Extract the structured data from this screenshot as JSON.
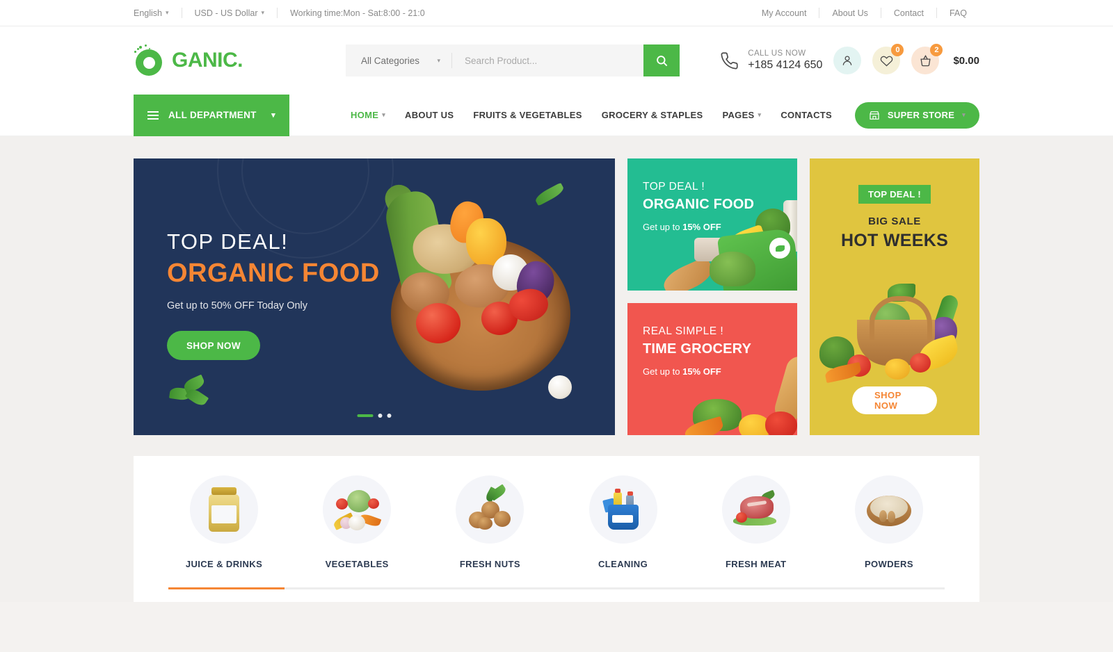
{
  "topbar": {
    "language": "English",
    "currency": "USD - US Dollar",
    "working_time": "Working time:Mon - Sat:8:00 - 21:0",
    "links": [
      {
        "label": "My Account"
      },
      {
        "label": "About Us"
      },
      {
        "label": "Contact"
      },
      {
        "label": "FAQ"
      }
    ]
  },
  "header": {
    "logo_letter": "C",
    "logo_text": "GANIC.",
    "search": {
      "category_selected": "All Categories",
      "placeholder": "Search Product...",
      "value": "",
      "button_icon": "search-icon"
    },
    "call": {
      "label": "CALL US NOW",
      "number": "+185 4124 650",
      "icon": "phone-icon"
    },
    "account_icon": "user-icon",
    "wishlist": {
      "icon": "heart-icon",
      "count": "0"
    },
    "cart": {
      "icon": "basket-icon",
      "count": "2",
      "total": "$0.00"
    }
  },
  "nav": {
    "department_button": "ALL DEPARTMENT",
    "links": [
      {
        "label": "HOME",
        "active": true,
        "has_dropdown": true
      },
      {
        "label": "ABOUT US",
        "active": false,
        "has_dropdown": false
      },
      {
        "label": "FRUITS & VEGETABLES",
        "active": false,
        "has_dropdown": false
      },
      {
        "label": "GROCERY & STAPLES",
        "active": false,
        "has_dropdown": false
      },
      {
        "label": "PAGES",
        "active": false,
        "has_dropdown": true
      },
      {
        "label": "CONTACTS",
        "active": false,
        "has_dropdown": false
      }
    ],
    "super_store": "SUPER STORE"
  },
  "hero": {
    "main": {
      "eyebrow": "TOP DEAL!",
      "title": "ORGANIC FOOD",
      "subtitle": "Get up to 50% OFF Today Only",
      "cta": "SHOP NOW",
      "slide_count": 3,
      "active_slide": 1
    },
    "teal_card": {
      "eyebrow": "TOP DEAL !",
      "title": "ORGANIC FOOD",
      "offer_prefix": "Get up to ",
      "offer_value": "15% OFF"
    },
    "red_card": {
      "eyebrow": "REAL SIMPLE !",
      "title": "TIME GROCERY",
      "offer_prefix": "Get up to ",
      "offer_value": "15% OFF"
    },
    "yellow_card": {
      "badge": "TOP DEAL !",
      "eyebrow": "BIG SALE",
      "title": "HOT WEEKS",
      "cta": "SHOP NOW"
    }
  },
  "categories": {
    "items": [
      {
        "label": "JUICE & DRINKS",
        "icon": "juice-jar-icon"
      },
      {
        "label": "VEGETABLES",
        "icon": "vegetables-icon"
      },
      {
        "label": "FRESH NUTS",
        "icon": "walnut-icon"
      },
      {
        "label": "CLEANING",
        "icon": "cleaning-bucket-icon"
      },
      {
        "label": "FRESH MEAT",
        "icon": "steak-icon"
      },
      {
        "label": "POWDERS",
        "icon": "powder-bowl-icon"
      }
    ]
  },
  "colors": {
    "brand_green": "#4cb847",
    "accent_orange": "#f58634",
    "hero_navy": "#21355a",
    "teal": "#23bd92",
    "red": "#f1564f",
    "yellow": "#e0c53f"
  }
}
